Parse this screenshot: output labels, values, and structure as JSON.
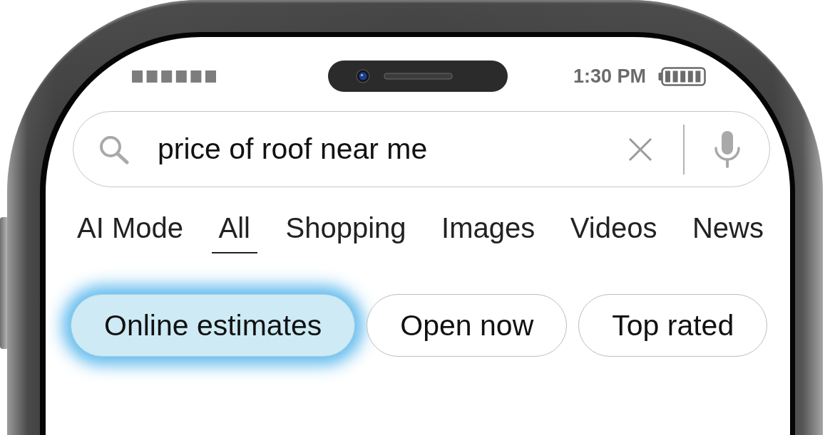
{
  "status_bar": {
    "time": "1:30 PM"
  },
  "search": {
    "value": "price of roof near me"
  },
  "tabs": [
    {
      "label": "AI Mode",
      "selected": false
    },
    {
      "label": "All",
      "selected": true
    },
    {
      "label": "Shopping",
      "selected": false
    },
    {
      "label": "Images",
      "selected": false
    },
    {
      "label": "Videos",
      "selected": false
    },
    {
      "label": "News",
      "selected": false
    }
  ],
  "chips": [
    {
      "label": "Online estimates",
      "selected": true
    },
    {
      "label": "Open now",
      "selected": false
    },
    {
      "label": "Top rated",
      "selected": false
    }
  ]
}
